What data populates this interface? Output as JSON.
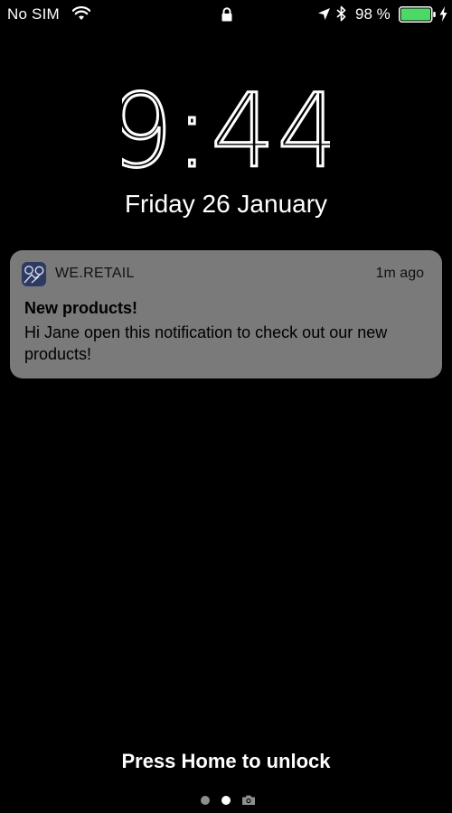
{
  "status_bar": {
    "carrier": "No SIM",
    "battery_percent": "98 %",
    "battery_level": 0.98,
    "icons": [
      "wifi-icon",
      "lock-icon",
      "location-icon",
      "bluetooth-icon",
      "battery-icon",
      "charging-icon"
    ],
    "battery_color": "#4cd964"
  },
  "lock_screen": {
    "time": "9:44",
    "date": "Friday 26 January",
    "unlock_hint": "Press Home to unlock"
  },
  "notification": {
    "app_name": "WE.RETAIL",
    "time_ago": "1m ago",
    "title": "New products!",
    "body": "Hi Jane open this notification to check out our new products!",
    "background_color": "#7a7a7a"
  },
  "page_indicator": {
    "pages": 2,
    "active_index": 1,
    "trailing_icon": "camera-icon"
  }
}
